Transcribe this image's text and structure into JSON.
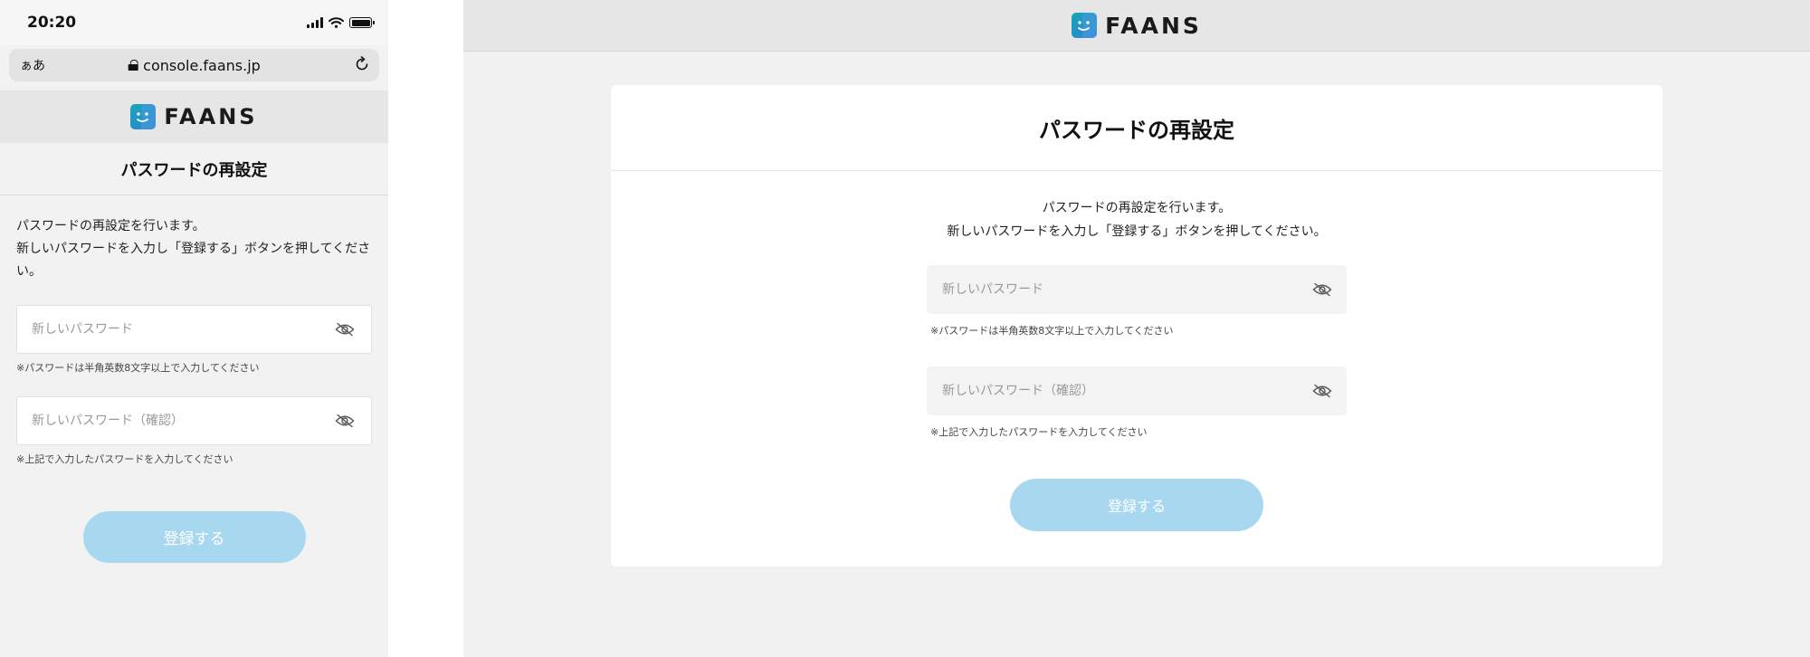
{
  "colors": {
    "button_bg": "#a8d8f0",
    "logo_teal": "#19a6b8",
    "logo_blue": "#2f7fd1"
  },
  "brand": {
    "name": "FAANS",
    "icon": "faans-logo-icon"
  },
  "mobile": {
    "status_bar": {
      "time": "20:20"
    },
    "url_bar": {
      "text_size": "ぁあ",
      "domain": "console.faans.jp"
    },
    "title": "パスワードの再設定",
    "description_line1": "パスワードの再設定を行います。",
    "description_line2": "新しいパスワードを入力し「登録する」ボタンを押してください。",
    "fields": [
      {
        "placeholder": "新しいパスワード",
        "note": "※パスワードは半角英数8文字以上で入力してください",
        "icon": "eye-slash-icon"
      },
      {
        "placeholder": "新しいパスワード（確認）",
        "note": "※上記で入力したパスワードを入力してください",
        "icon": "eye-slash-icon"
      }
    ],
    "submit_label": "登録する"
  },
  "desktop": {
    "title": "パスワードの再設定",
    "description_line1": "パスワードの再設定を行います。",
    "description_line2": "新しいパスワードを入力し「登録する」ボタンを押してください。",
    "fields": [
      {
        "placeholder": "新しいパスワード",
        "note": "※パスワードは半角英数8文字以上で入力してください",
        "icon": "eye-slash-icon"
      },
      {
        "placeholder": "新しいパスワード（確認）",
        "note": "※上記で入力したパスワードを入力してください",
        "icon": "eye-slash-icon"
      }
    ],
    "submit_label": "登録する"
  }
}
